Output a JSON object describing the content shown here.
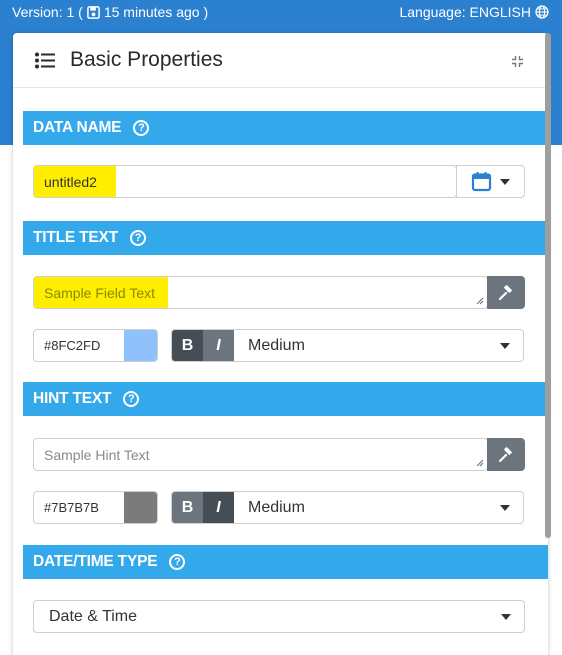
{
  "topbar": {
    "version_label": "Version: 1 (",
    "saved_time": "15 minutes ago )",
    "language_label": "Language: ENGLISH"
  },
  "panel": {
    "title": "Basic Properties"
  },
  "sections": {
    "data_name": {
      "heading": "DATA NAME",
      "value": "untitled2"
    },
    "title_text": {
      "heading": "TITLE TEXT",
      "placeholder": "Sample Field Text",
      "color_hex": "#8FC2FD",
      "color": "#8FC2FD",
      "bold_label": "B",
      "italic_label": "I",
      "size_value": "Medium"
    },
    "hint_text": {
      "heading": "HINT TEXT",
      "placeholder": "Sample Hint Text",
      "color_hex": "#7B7B7B",
      "color": "#7B7B7B",
      "bold_label": "B",
      "italic_label": "I",
      "size_value": "Medium"
    },
    "datetime_type": {
      "heading": "DATE/TIME TYPE",
      "value": "Date & Time"
    }
  },
  "colors": {
    "top_band": "#2b80d0",
    "section_bar": "#33a8ea",
    "highlight": "#ffee00",
    "button_gray": "#6c757d",
    "button_dark": "#454d55"
  }
}
